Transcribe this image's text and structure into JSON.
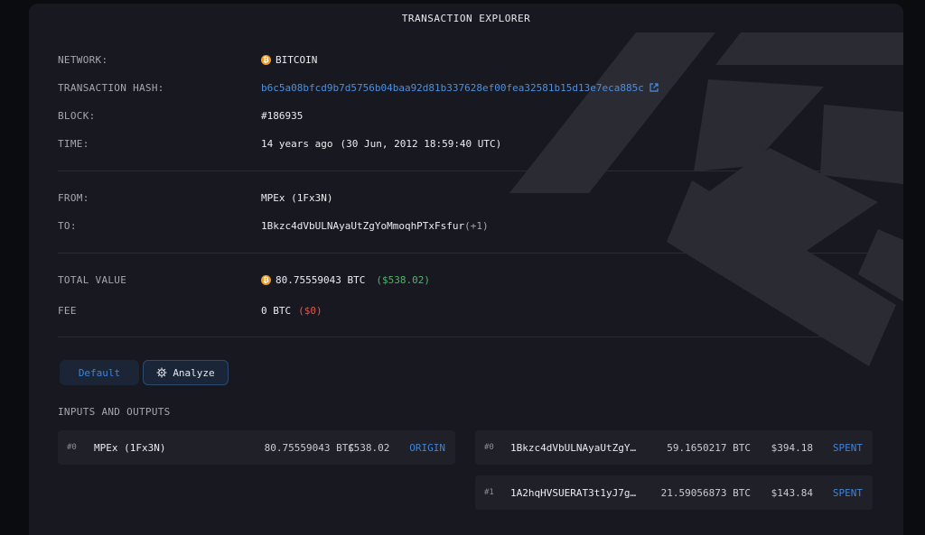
{
  "header": {
    "title": "TRANSACTION EXPLORER"
  },
  "details": {
    "network": {
      "label": "NETWORK:",
      "value": "BITCOIN"
    },
    "hash": {
      "label": "TRANSACTION HASH:",
      "value": "b6c5a08bfcd9b7d5756b04baa92d81b337628ef00fea32581b15d13e7eca885c"
    },
    "block": {
      "label": "BLOCK:",
      "value": "#186935"
    },
    "time": {
      "label": "TIME:",
      "relative": "14 years ago",
      "absolute": "(30 Jun, 2012 18:59:40 UTC)"
    },
    "from": {
      "label": "FROM:",
      "value": "MPEx (1Fx3N)"
    },
    "to": {
      "label": "TO:",
      "value": "1Bkzc4dVbULNAyaUtZgYoMmoqhPTxFsfur",
      "extra": "(+1)"
    },
    "total": {
      "label": "TOTAL VALUE",
      "btc": "80.75559043 BTC",
      "usd": "($538.02)"
    },
    "fee": {
      "label": "FEE",
      "btc": "0 BTC",
      "usd": "($0)"
    }
  },
  "view_toggle": {
    "default_label": "Default",
    "analyze_label": "Analyze"
  },
  "io": {
    "title": "INPUTS AND OUTPUTS",
    "inputs": [
      {
        "index": "#0",
        "address": "MPEx (1Fx3N)",
        "amount": "80.75559043 BTC",
        "usd": "$538.02",
        "status": "ORIGIN"
      }
    ],
    "outputs": [
      {
        "index": "#0",
        "address": "1Bkzc4dVbULNAyaUtZgY…",
        "amount": "59.1650217 BTC",
        "usd": "$394.18",
        "status": "SPENT"
      },
      {
        "index": "#1",
        "address": "1A2hqHVSUERAT3t1yJ7g…",
        "amount": "21.59056873 BTC",
        "usd": "$143.84",
        "status": "SPENT"
      }
    ]
  },
  "colors": {
    "accent": "#3f83d8",
    "bitcoin": "#f29b1a",
    "positive": "#4fb36b",
    "negative": "#e0564e"
  },
  "icons": {
    "network": "bitcoin-icon",
    "hash_link": "external-link-icon",
    "analyze": "gear-icon"
  }
}
